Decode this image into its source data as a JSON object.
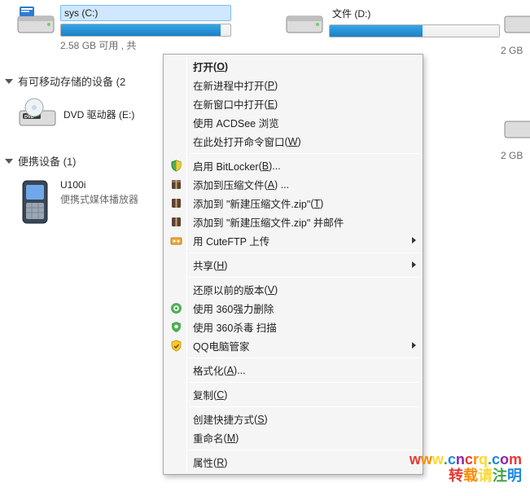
{
  "drives": {
    "c": {
      "title": "sys (C:)",
      "sub": "2.58 GB 可用 , 共",
      "fill_pct": 94
    },
    "d": {
      "title": "文件 (D:)",
      "sub": "",
      "fill_pct": 55
    }
  },
  "right_fragments": {
    "f1": "2 GB",
    "f2": "2 GB"
  },
  "sections": {
    "removable": "有可移动存储的设备 (2",
    "portable": "便携设备 (1)"
  },
  "dvd": {
    "label": "DVD 驱动器 (E:)"
  },
  "phone": {
    "title": "U100i",
    "sub": "便携式媒体播放器"
  },
  "context_menu": {
    "open": "打开",
    "open_new_process": "在新进程中打开",
    "open_new_window": "在新窗口中打开",
    "acdsee": "使用 ACDSee 浏览",
    "cmd_here": "在此处打开命令窗口",
    "bitlocker": "启用 BitLocker",
    "add_archive": "添加到压缩文件",
    "add_zip": "添加到 \"新建压缩文件.zip\"",
    "add_zip_mail": "添加到 \"新建压缩文件.zip\" 并邮件",
    "cuteftp": "用 CuteFTP 上传",
    "share": "共享",
    "restore_prev": "还原以前的版本",
    "del360": "使用 360强力删除",
    "scan360": "使用 360杀毒 扫描",
    "qqguard": "QQ电脑管家",
    "format": "格式化",
    "copy": "复制",
    "create_shortcut": "创建快捷方式",
    "rename": "重命名",
    "properties": "属性"
  },
  "watermark": {
    "line1": "www.cncrq.com",
    "line2": "转载请注明"
  }
}
